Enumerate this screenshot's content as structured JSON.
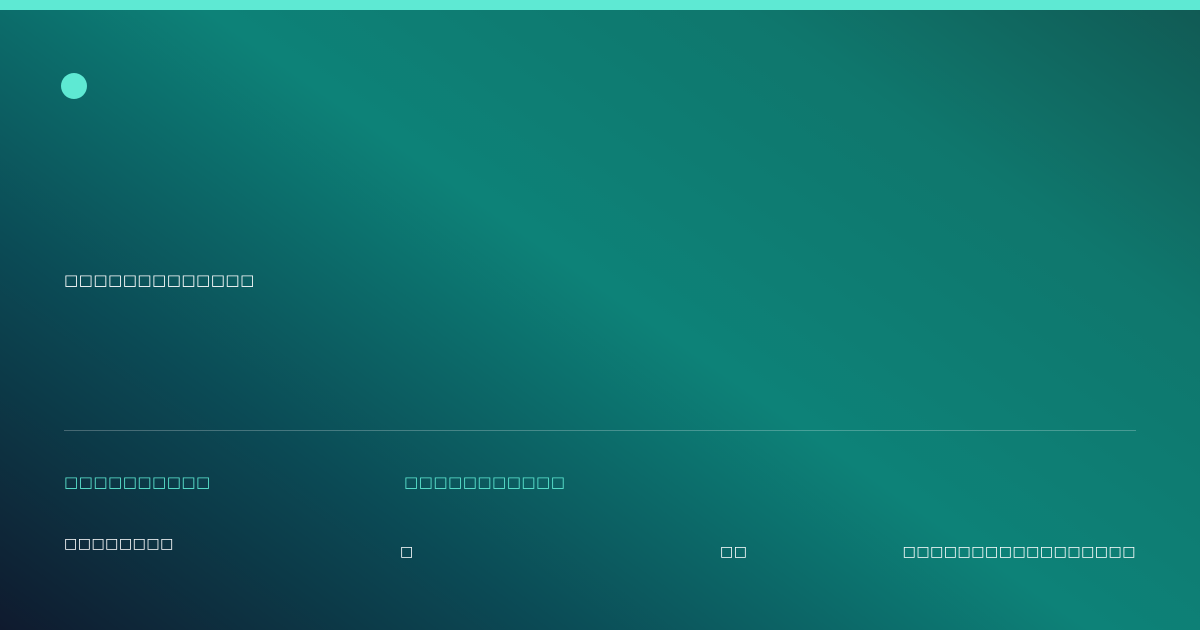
{
  "colors": {
    "accent": "#5ee9d3",
    "background_dark": "#0f1a2e",
    "background_teal": "#0d8278"
  },
  "hero": {
    "headline": "□□□□□□□□□□□□□"
  },
  "meta": {
    "label_left": "□□□□□□□□□□",
    "label_mid": "□□□□□□□□□□□"
  },
  "footer": {
    "text_a": "□□□□□□□□",
    "text_b": "□",
    "text_c": "□□",
    "text_d": "□□□□□□□□□□□□□□□□□"
  }
}
